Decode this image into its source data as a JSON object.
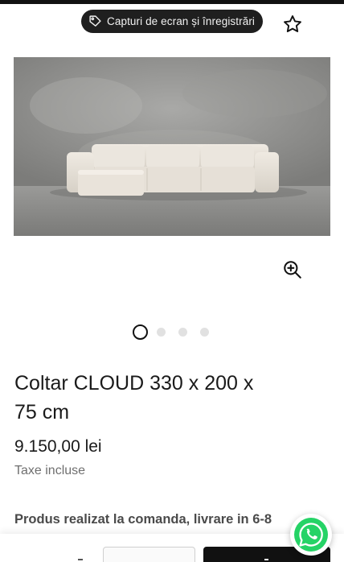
{
  "toolbar": {
    "screenshot_label": "Capturi de ecran și înregistrări"
  },
  "product": {
    "title": "Coltar CLOUD 330 x 200 x 75 cm",
    "price": "9.150,00 lei",
    "tax_note": "Taxe incluse",
    "production_note": "Produs realizat la comanda, livrare in 6-8"
  },
  "gallery": {
    "image_count": 4,
    "active_index": 0
  },
  "icons": {
    "tag": "tag-icon",
    "favorite": "star-icon",
    "zoom": "zoom-in-icon",
    "chat": "whatsapp-icon"
  },
  "colors": {
    "dark": "#111111",
    "whatsapp_green": "#25D366",
    "inactive_dot": "#e1e1e1"
  }
}
